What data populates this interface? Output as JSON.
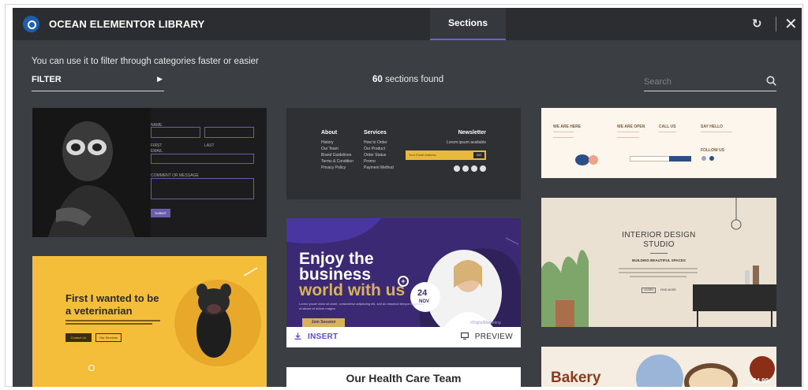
{
  "header": {
    "title": "OCEAN ELEMENTOR LIBRARY",
    "tab_label": "Sections",
    "sync_icon": "sync-icon",
    "close_icon": "close-icon"
  },
  "toolbar": {
    "hint": "You can use it to filter through categories faster or easier",
    "filter_label": "FILTER",
    "found_count": "60",
    "found_text": "sections found",
    "search_placeholder": "Search"
  },
  "cards": {
    "footer": {
      "about_title": "About",
      "about_items": [
        "History",
        "Our Team",
        "Brand Guidelines",
        "Terms & Condition",
        "Privacy Policy"
      ],
      "services_title": "Services",
      "services_items": [
        "How to Order",
        "Our Product",
        "Order Status",
        "Promo",
        "Payment Method"
      ],
      "newsletter_title": "Newsletter",
      "newsletter_sub": "Lorem ipsum available",
      "newsletter_placeholder": "Your Email Address",
      "newsletter_go": "GO"
    },
    "contact": {
      "labels": [
        "WE ARE HERE",
        "WE ARE OPEN",
        "CALL US",
        "SAY HELLO"
      ],
      "follow": "FOLLOW US"
    },
    "form": {
      "labels": [
        "NAME",
        "FIRST",
        "LAST",
        "EMAIL",
        "COMMENT OR MESSAGE"
      ],
      "submit": "SUBMIT"
    },
    "business": {
      "line1": "Enjoy the",
      "line2": "business",
      "line3": "world with us",
      "date_day": "24",
      "date_month": "NOV",
      "desc": "Lorem ipsum dolor sit amet, consectetur adipiscing elit, sed do eiusmod tempor incididunt ut labore et dolore magna",
      "button": "Join Session",
      "tag": "#DigitalMarketing",
      "insert_label": "INSERT",
      "preview_label": "PREVIEW"
    },
    "interior": {
      "title_1": "INTERIOR DESIGN",
      "title_2": "STUDIO",
      "subtitle": "BUILDING BEAUTIFUL SPACES",
      "btn_1": "LEARN",
      "btn_2": "FIND MORE"
    },
    "vet": {
      "line1": "First I wanted to be",
      "line2": "a veterinarian",
      "btn_1": "Contact Us",
      "btn_2": "Our Services"
    },
    "health": {
      "title": "Our Health Care Team"
    },
    "bakery": {
      "title": "Bakery",
      "price": "$4.99"
    }
  },
  "colors": {
    "modal_bg": "#3b3e42",
    "topbar_bg": "#2b2d31",
    "accent": "#6c5ce7"
  }
}
